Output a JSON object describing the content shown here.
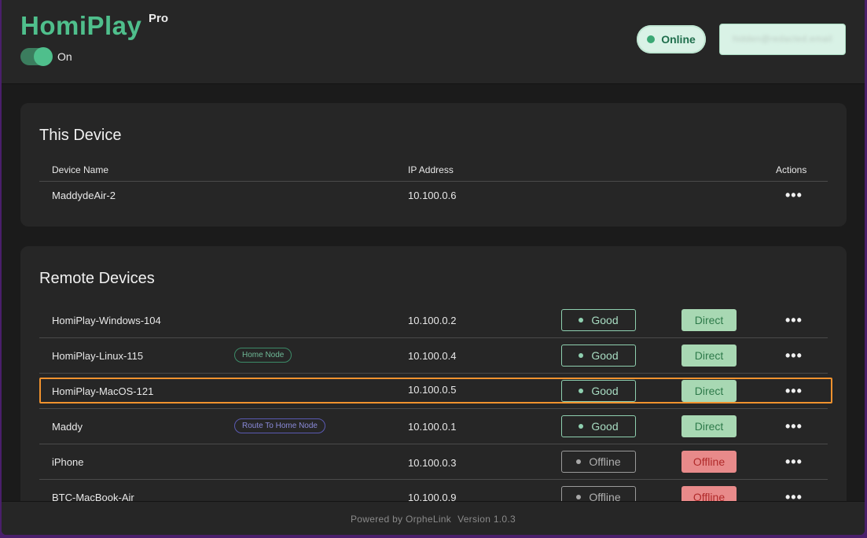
{
  "header": {
    "brand": "HomiPlay",
    "edition": "Pro",
    "toggle_label": "On",
    "toggle_on": true,
    "status_label": "Online",
    "account_label": "hidden@redacted.email"
  },
  "this_device": {
    "title": "This Device",
    "columns": {
      "name": "Device Name",
      "ip": "IP Address",
      "actions": "Actions"
    },
    "rows": [
      {
        "name": "MaddydeAir-2",
        "ip": "10.100.0.6",
        "actions_icon": "more-icon"
      }
    ]
  },
  "remote_devices": {
    "title": "Remote Devices",
    "rows": [
      {
        "name": "HomiPlay-Windows-104",
        "tag": "",
        "ip": "10.100.0.2",
        "quality": "Good",
        "connection": "Direct"
      },
      {
        "name": "HomiPlay-Linux-115",
        "tag": "Home Node",
        "ip": "10.100.0.4",
        "quality": "Good",
        "connection": "Direct"
      },
      {
        "name": "HomiPlay-MacOS-121",
        "tag": "",
        "ip": "10.100.0.5",
        "quality": "Good",
        "connection": "Direct"
      },
      {
        "name": "Maddy",
        "tag": "Route To Home Node",
        "ip": "10.100.0.1",
        "quality": "Good",
        "connection": "Direct"
      },
      {
        "name": "iPhone",
        "tag": "",
        "ip": "10.100.0.3",
        "quality": "Offline",
        "connection": "Offline"
      },
      {
        "name": "BTC-MacBook-Air",
        "tag": "",
        "ip": "10.100.0.9",
        "quality": "Offline",
        "connection": "Offline"
      }
    ]
  },
  "footer": {
    "powered_by": "Powered by OrpheLink",
    "version": "Version 1.0.3"
  },
  "colors": {
    "brand": "#4fbf8c",
    "highlight": "#f0922e",
    "good": "#8fd0b0",
    "direct_bg": "#a8d8b3",
    "offline_bg": "#e88a8a"
  }
}
